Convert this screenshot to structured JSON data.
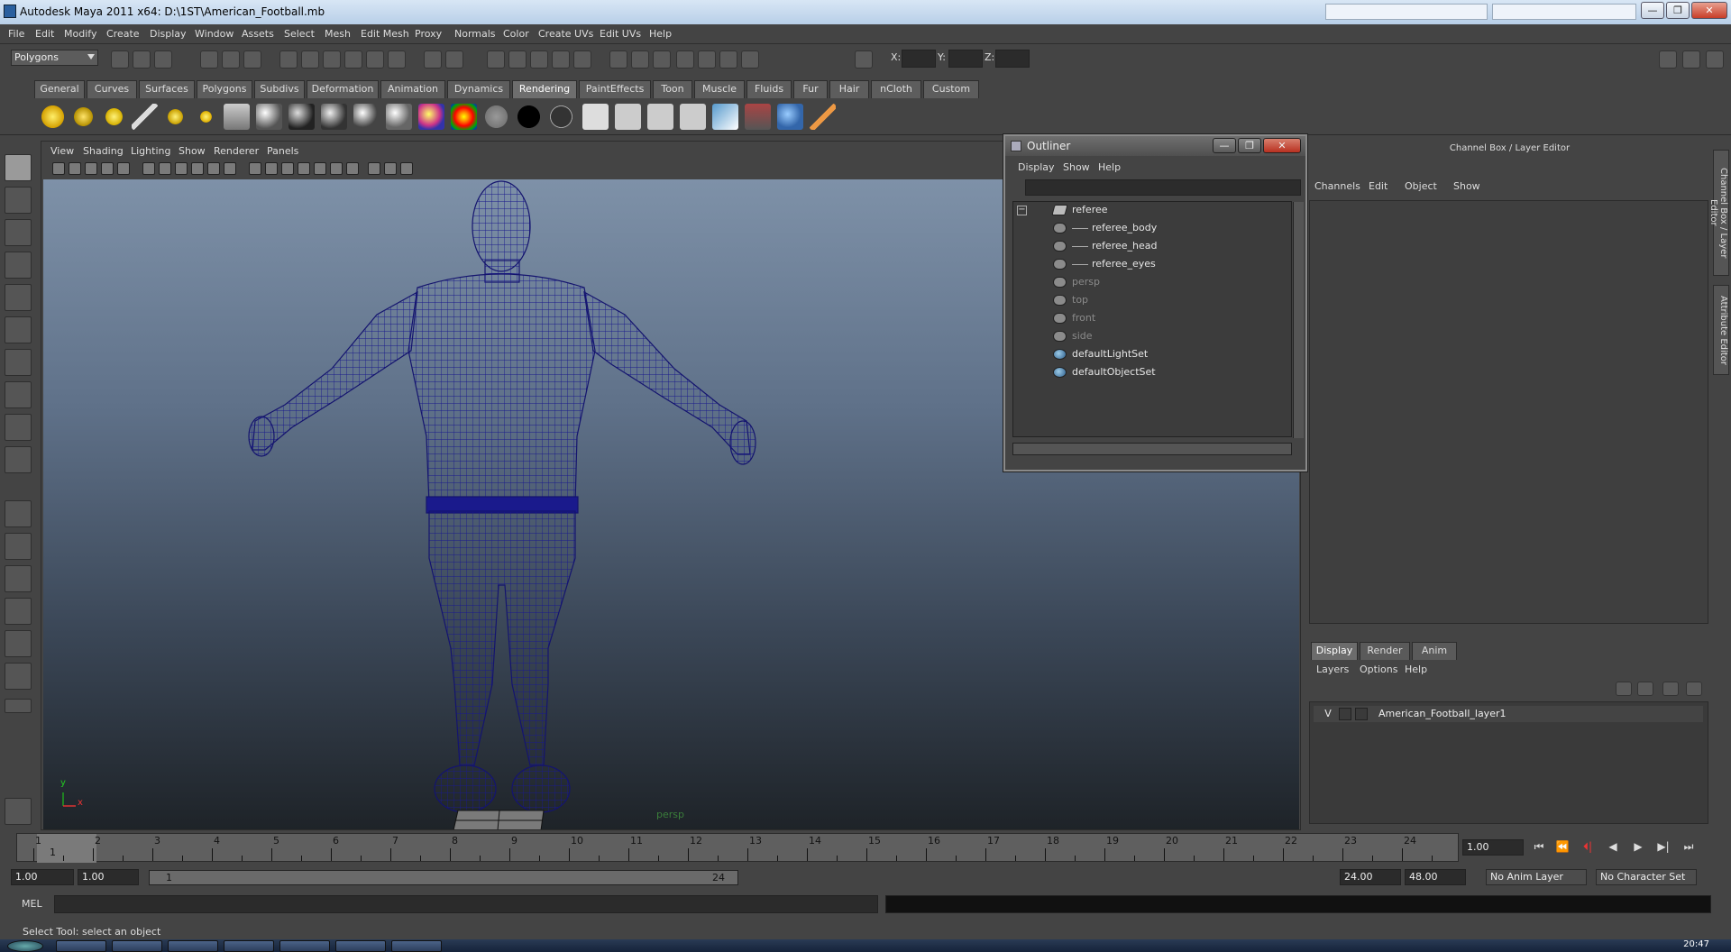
{
  "title": "Autodesk Maya 2011 x64: D:\\1ST\\American_Football.mb",
  "window_buttons": {
    "minimize": "—",
    "maximize": "❐",
    "close": "✕"
  },
  "menus": [
    "File",
    "Edit",
    "Modify",
    "Create",
    "Display",
    "Window",
    "Assets",
    "Select",
    "Mesh",
    "Edit Mesh",
    "Proxy",
    "Normals",
    "Color",
    "Create UVs",
    "Edit UVs",
    "Help"
  ],
  "mode_selector": "Polygons",
  "coord_labels": {
    "x": "X:",
    "y": "Y:",
    "z": "Z:"
  },
  "shelf_tabs": [
    "General",
    "Curves",
    "Surfaces",
    "Polygons",
    "Subdivs",
    "Deformation",
    "Animation",
    "Dynamics",
    "Rendering",
    "PaintEffects",
    "Toon",
    "Muscle",
    "Fluids",
    "Fur",
    "Hair",
    "nCloth",
    "Custom"
  ],
  "active_shelf_tab": "Rendering",
  "viewport": {
    "menus": [
      "View",
      "Shading",
      "Lighting",
      "Show",
      "Renderer",
      "Panels"
    ],
    "camera_label": "persp",
    "axis_y": "y",
    "axis_x": "x"
  },
  "outliner": {
    "title": "Outliner",
    "menus": [
      "Display",
      "Show",
      "Help"
    ],
    "items": [
      {
        "label": "referee",
        "dim": false,
        "indent": 0,
        "icon": "group"
      },
      {
        "label": "referee_body",
        "dim": false,
        "indent": 1,
        "icon": "mesh"
      },
      {
        "label": "referee_head",
        "dim": false,
        "indent": 1,
        "icon": "mesh"
      },
      {
        "label": "referee_eyes",
        "dim": false,
        "indent": 1,
        "icon": "mesh"
      },
      {
        "label": "persp",
        "dim": true,
        "indent": 0,
        "icon": "camera"
      },
      {
        "label": "top",
        "dim": true,
        "indent": 0,
        "icon": "camera"
      },
      {
        "label": "front",
        "dim": true,
        "indent": 0,
        "icon": "camera"
      },
      {
        "label": "side",
        "dim": true,
        "indent": 0,
        "icon": "camera"
      },
      {
        "label": "defaultLightSet",
        "dim": false,
        "indent": 0,
        "icon": "set"
      },
      {
        "label": "defaultObjectSet",
        "dim": false,
        "indent": 0,
        "icon": "set"
      }
    ]
  },
  "channel_box": {
    "title": "Channel Box / Layer Editor",
    "menus": [
      "Channels",
      "Edit",
      "Object",
      "Show"
    ]
  },
  "side_tabs": [
    "Channel Box / Layer Editor",
    "Attribute Editor"
  ],
  "layer_editor": {
    "tabs": [
      "Display",
      "Render",
      "Anim"
    ],
    "active_tab": "Display",
    "menus": [
      "Layers",
      "Options",
      "Help"
    ],
    "layers": [
      {
        "visible": "V",
        "name": "American_Football_layer1"
      }
    ]
  },
  "timeline": {
    "ticks": [
      "1",
      "2",
      "3",
      "4",
      "5",
      "6",
      "7",
      "8",
      "9",
      "10",
      "11",
      "12",
      "13",
      "14",
      "15",
      "16",
      "17",
      "18",
      "19",
      "20",
      "21",
      "22",
      "23",
      "24"
    ],
    "current_frame_marker": "1",
    "current_frame": "1.00",
    "playback_buttons": [
      "⏮",
      "⏪",
      "⏴|",
      "◀",
      "▶",
      "▶|",
      "⏭"
    ]
  },
  "range": {
    "start": "1.00",
    "playback_start": "1.00",
    "slider_start": "1",
    "slider_end": "24",
    "playback_end": "24.00",
    "end": "48.00",
    "anim_layer": "No Anim Layer",
    "character_set": "No Character Set"
  },
  "mel_label": "MEL",
  "help_line": "Select Tool: select an object",
  "clock": "20:47",
  "colors": {
    "wireframe": "#1a1a8c",
    "ui_bg": "#444444",
    "viewport_top": "#7e91a8",
    "viewport_bottom": "#1e2328",
    "camera_label": "#3a7e3a"
  }
}
